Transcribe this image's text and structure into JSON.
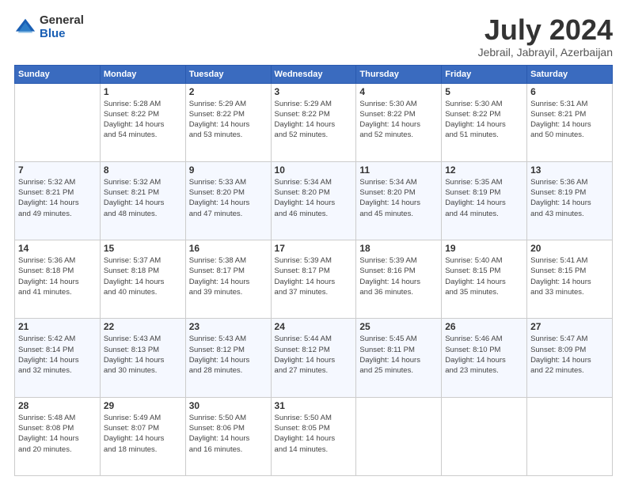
{
  "logo": {
    "general": "General",
    "blue": "Blue"
  },
  "title": "July 2024",
  "location": "Jebrail, Jabrayil, Azerbaijan",
  "days_header": [
    "Sunday",
    "Monday",
    "Tuesday",
    "Wednesday",
    "Thursday",
    "Friday",
    "Saturday"
  ],
  "weeks": [
    [
      {
        "day": "",
        "info": ""
      },
      {
        "day": "1",
        "info": "Sunrise: 5:28 AM\nSunset: 8:22 PM\nDaylight: 14 hours\nand 54 minutes."
      },
      {
        "day": "2",
        "info": "Sunrise: 5:29 AM\nSunset: 8:22 PM\nDaylight: 14 hours\nand 53 minutes."
      },
      {
        "day": "3",
        "info": "Sunrise: 5:29 AM\nSunset: 8:22 PM\nDaylight: 14 hours\nand 52 minutes."
      },
      {
        "day": "4",
        "info": "Sunrise: 5:30 AM\nSunset: 8:22 PM\nDaylight: 14 hours\nand 52 minutes."
      },
      {
        "day": "5",
        "info": "Sunrise: 5:30 AM\nSunset: 8:22 PM\nDaylight: 14 hours\nand 51 minutes."
      },
      {
        "day": "6",
        "info": "Sunrise: 5:31 AM\nSunset: 8:21 PM\nDaylight: 14 hours\nand 50 minutes."
      }
    ],
    [
      {
        "day": "7",
        "info": "Sunrise: 5:32 AM\nSunset: 8:21 PM\nDaylight: 14 hours\nand 49 minutes."
      },
      {
        "day": "8",
        "info": "Sunrise: 5:32 AM\nSunset: 8:21 PM\nDaylight: 14 hours\nand 48 minutes."
      },
      {
        "day": "9",
        "info": "Sunrise: 5:33 AM\nSunset: 8:20 PM\nDaylight: 14 hours\nand 47 minutes."
      },
      {
        "day": "10",
        "info": "Sunrise: 5:34 AM\nSunset: 8:20 PM\nDaylight: 14 hours\nand 46 minutes."
      },
      {
        "day": "11",
        "info": "Sunrise: 5:34 AM\nSunset: 8:20 PM\nDaylight: 14 hours\nand 45 minutes."
      },
      {
        "day": "12",
        "info": "Sunrise: 5:35 AM\nSunset: 8:19 PM\nDaylight: 14 hours\nand 44 minutes."
      },
      {
        "day": "13",
        "info": "Sunrise: 5:36 AM\nSunset: 8:19 PM\nDaylight: 14 hours\nand 43 minutes."
      }
    ],
    [
      {
        "day": "14",
        "info": "Sunrise: 5:36 AM\nSunset: 8:18 PM\nDaylight: 14 hours\nand 41 minutes."
      },
      {
        "day": "15",
        "info": "Sunrise: 5:37 AM\nSunset: 8:18 PM\nDaylight: 14 hours\nand 40 minutes."
      },
      {
        "day": "16",
        "info": "Sunrise: 5:38 AM\nSunset: 8:17 PM\nDaylight: 14 hours\nand 39 minutes."
      },
      {
        "day": "17",
        "info": "Sunrise: 5:39 AM\nSunset: 8:17 PM\nDaylight: 14 hours\nand 37 minutes."
      },
      {
        "day": "18",
        "info": "Sunrise: 5:39 AM\nSunset: 8:16 PM\nDaylight: 14 hours\nand 36 minutes."
      },
      {
        "day": "19",
        "info": "Sunrise: 5:40 AM\nSunset: 8:15 PM\nDaylight: 14 hours\nand 35 minutes."
      },
      {
        "day": "20",
        "info": "Sunrise: 5:41 AM\nSunset: 8:15 PM\nDaylight: 14 hours\nand 33 minutes."
      }
    ],
    [
      {
        "day": "21",
        "info": "Sunrise: 5:42 AM\nSunset: 8:14 PM\nDaylight: 14 hours\nand 32 minutes."
      },
      {
        "day": "22",
        "info": "Sunrise: 5:43 AM\nSunset: 8:13 PM\nDaylight: 14 hours\nand 30 minutes."
      },
      {
        "day": "23",
        "info": "Sunrise: 5:43 AM\nSunset: 8:12 PM\nDaylight: 14 hours\nand 28 minutes."
      },
      {
        "day": "24",
        "info": "Sunrise: 5:44 AM\nSunset: 8:12 PM\nDaylight: 14 hours\nand 27 minutes."
      },
      {
        "day": "25",
        "info": "Sunrise: 5:45 AM\nSunset: 8:11 PM\nDaylight: 14 hours\nand 25 minutes."
      },
      {
        "day": "26",
        "info": "Sunrise: 5:46 AM\nSunset: 8:10 PM\nDaylight: 14 hours\nand 23 minutes."
      },
      {
        "day": "27",
        "info": "Sunrise: 5:47 AM\nSunset: 8:09 PM\nDaylight: 14 hours\nand 22 minutes."
      }
    ],
    [
      {
        "day": "28",
        "info": "Sunrise: 5:48 AM\nSunset: 8:08 PM\nDaylight: 14 hours\nand 20 minutes."
      },
      {
        "day": "29",
        "info": "Sunrise: 5:49 AM\nSunset: 8:07 PM\nDaylight: 14 hours\nand 18 minutes."
      },
      {
        "day": "30",
        "info": "Sunrise: 5:50 AM\nSunset: 8:06 PM\nDaylight: 14 hours\nand 16 minutes."
      },
      {
        "day": "31",
        "info": "Sunrise: 5:50 AM\nSunset: 8:05 PM\nDaylight: 14 hours\nand 14 minutes."
      },
      {
        "day": "",
        "info": ""
      },
      {
        "day": "",
        "info": ""
      },
      {
        "day": "",
        "info": ""
      }
    ]
  ]
}
